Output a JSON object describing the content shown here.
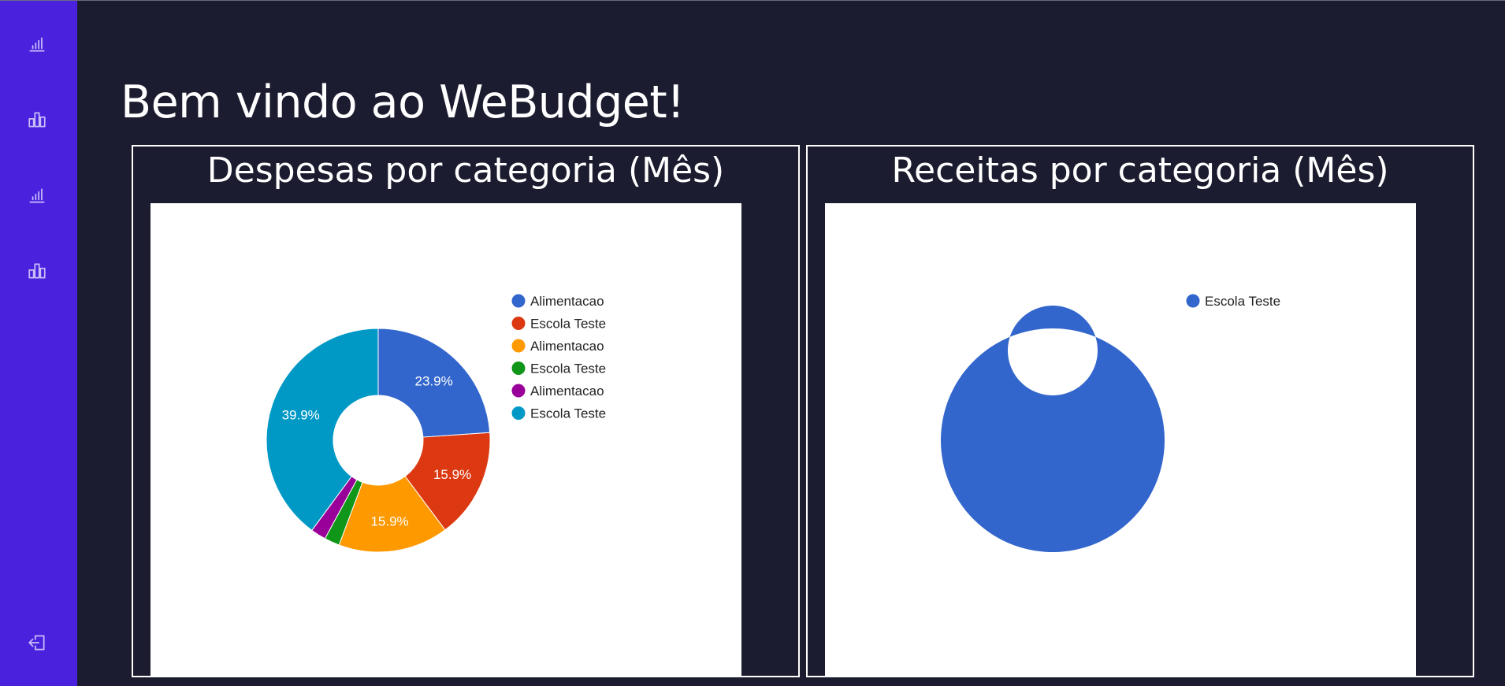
{
  "app": {
    "title": "Bem vindo ao WeBudget!"
  },
  "sidebar": {
    "items": [
      {
        "icon": "signal-bars-icon"
      },
      {
        "icon": "bar-chart-icon"
      },
      {
        "icon": "signal-bars-icon"
      },
      {
        "icon": "bar-chart-icon"
      }
    ],
    "logout_icon": "logout-icon"
  },
  "colors": {
    "sidebar": "#4a22dd",
    "background": "#1c1c30",
    "panel_border": "#ffffff"
  },
  "panels": [
    {
      "title": "Despesas por categoria (Mês)"
    },
    {
      "title": "Receitas por categoria (Mês)"
    }
  ],
  "chart_data": [
    {
      "type": "pie",
      "donut": true,
      "title": "",
      "legend_position": "right",
      "slices": [
        {
          "label": "Alimentacao",
          "percent": 23.9,
          "color": "#3366cc",
          "show_label": true
        },
        {
          "label": "Escola Teste",
          "percent": 15.9,
          "color": "#dc3912",
          "show_label": true
        },
        {
          "label": "Alimentacao",
          "percent": 15.9,
          "color": "#ff9900",
          "show_label": true
        },
        {
          "label": "Escola Teste",
          "percent": 2.2,
          "color": "#109618",
          "show_label": false
        },
        {
          "label": "Alimentacao",
          "percent": 2.2,
          "color": "#990099",
          "show_label": false
        },
        {
          "label": "Escola Teste",
          "percent": 39.9,
          "color": "#0099c6",
          "show_label": true
        }
      ],
      "slice_labels": [
        "23.9%",
        "15.9%",
        "15.9%",
        "",
        "",
        "39.9%"
      ]
    },
    {
      "type": "pie",
      "donut": true,
      "title": "",
      "legend_position": "right",
      "slices": [
        {
          "label": "Escola Teste",
          "percent": 100,
          "color": "#3366cc",
          "show_label": false
        }
      ],
      "slice_labels": [
        ""
      ]
    }
  ]
}
